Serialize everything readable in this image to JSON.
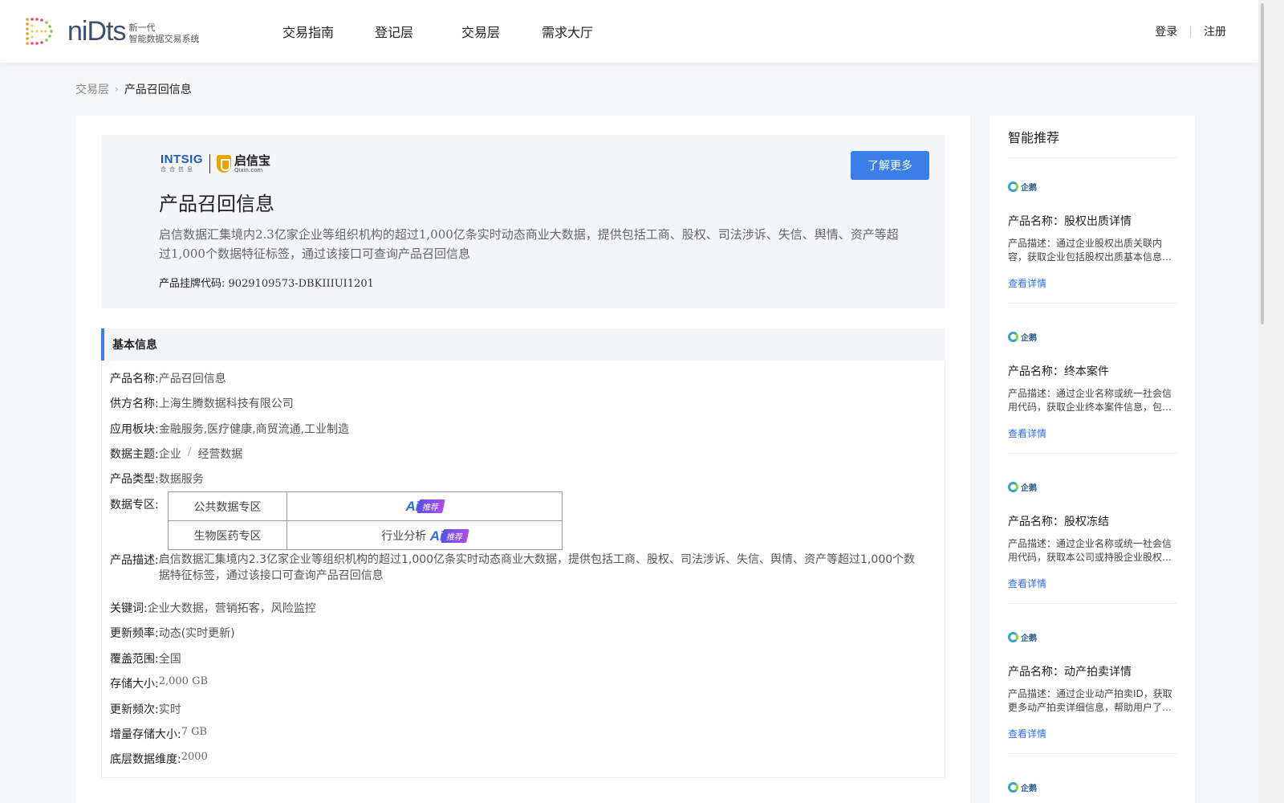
{
  "header": {
    "logo_word": "niDts",
    "logo_sub_line1": "新一代",
    "logo_sub_line2": "智能数据交易系统",
    "nav": [
      "交易指南",
      "登记层",
      "交易层",
      "需求大厅"
    ],
    "login": "登录",
    "register": "注册"
  },
  "breadcrumb": {
    "parent": "交易层",
    "current": "产品召回信息"
  },
  "banner": {
    "brand_en": "INTSIG",
    "brand_en_sub": "合合信息",
    "brand_cn": "启信宝",
    "brand_cn_sub": "Qixin.com",
    "learn_more": "了解更多",
    "title": "产品召回信息",
    "description": "启信数据汇集境内2.3亿家企业等组织机构的超过1,000亿条实时动态商业大数据，提供包括工商、股权、司法涉诉、失信、舆情、资产等超过1,000个数据特征标签，通过该接口可查询产品召回信息",
    "code_label": "产品挂牌代码:",
    "code_value": "9029109573-DBKIIIUI1201"
  },
  "basic_info": {
    "section_title": "基本信息",
    "product_name_label": "产品名称:",
    "product_name": "产品召回信息",
    "supplier_label": "供方名称:",
    "supplier": "上海生腾数据科技有限公司",
    "sector_label": "应用板块:",
    "sector": "金融服务,医疗健康,商贸流通,工业制造",
    "theme_label": "数据主题:",
    "theme_primary": "企业",
    "theme_divider": "/",
    "theme_secondary": "经营数据",
    "type_label": "产品类型:",
    "type": "数据服务",
    "zone_label": "数据专区:",
    "zones": [
      {
        "name": "公共数据专区",
        "tag_text": "",
        "ai": "Ai",
        "ai_tag": "推荐"
      },
      {
        "name": "生物医药专区",
        "tag_text": "行业分析",
        "ai": "Ai",
        "ai_tag": "推荐"
      }
    ],
    "desc_label": "产品描述:",
    "desc": "启信数据汇集境内2.3亿家企业等组织机构的超过1,000亿条实时动态商业大数据，提供包括工商、股权、司法涉诉、失信、舆情、资产等超过1,000个数据特征标签，通过该接口可查询产品召回信息",
    "keywords_label": "关键词:",
    "keywords": "企业大数据，营销拓客，风险监控",
    "freq_label": "更新频率:",
    "freq": "动态(实时更新)",
    "coverage_label": "覆盖范围:",
    "coverage": "全国",
    "storage_label": "存储大小:",
    "storage": "2,000 GB",
    "update_label": "更新频次:",
    "update": "实时",
    "incr_label": "增量存储大小:",
    "incr": "7 GB",
    "dim_label": "底层数据维度:",
    "dim": "2000"
  },
  "sidebar": {
    "title": "智能推荐",
    "logo_text": "企鹅",
    "link_text": "查看详情",
    "items": [
      {
        "name": "产品名称：股权出质详情",
        "desc": "产品描述：通过企业股权出质关联内容，获取企业包括股权出质基本信息等详细数据内容"
      },
      {
        "name": "产品名称：终本案件",
        "desc": "产品描述：通过企业名称或统一社会信用代码，获取企业终本案件信息，包括案号等"
      },
      {
        "name": "产品名称：股权冻结",
        "desc": "产品描述：通过企业名称或统一社会信用代码，获取本公司或持股企业股权冻结信息"
      },
      {
        "name": "产品名称：动产拍卖详情",
        "desc": "产品描述：通过企业动产拍卖ID，获取更多动产拍卖详细信息，帮助用户了解相关信息"
      }
    ]
  }
}
